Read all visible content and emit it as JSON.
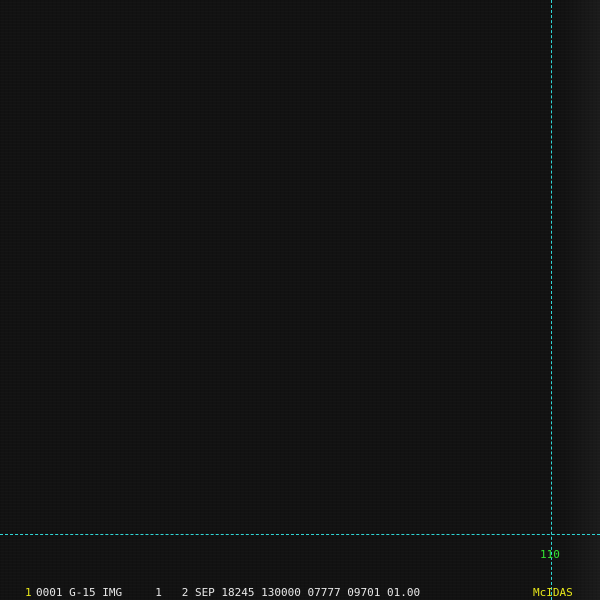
{
  "display": {
    "frame_number": "1",
    "image_info": "0001 G-15 IMG     1   2 SEP 18245 130000 07777 09701 01.00",
    "mcidas_label": "McIDAS"
  },
  "overlay": {
    "grid_label": "110",
    "line_color": "#2fd6d6",
    "label_color": "#33e233"
  },
  "colors": {
    "background": "#121212",
    "status_text": "#e6e6e6",
    "frame_accent": "#e6e61a"
  }
}
